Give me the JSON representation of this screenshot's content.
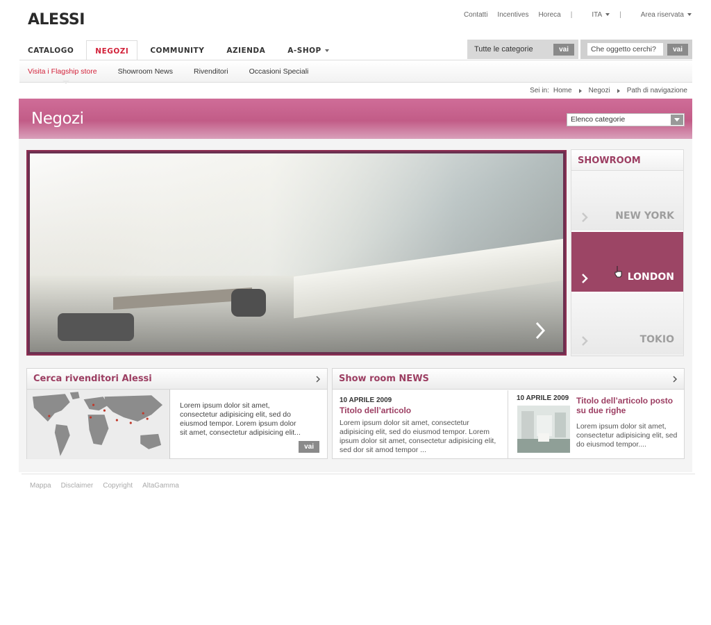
{
  "brand": {
    "logo": "ALESSI"
  },
  "top_links": {
    "contatti": "Contatti",
    "incentives": "Incentives",
    "horeca": "Horeca",
    "sep": "|",
    "language": "ITA",
    "area": "Area riservata"
  },
  "main_nav": [
    {
      "label": "CATALOGO"
    },
    {
      "label": "NEGOZI",
      "active": true
    },
    {
      "label": "COMMUNITY"
    },
    {
      "label": "AZIENDA"
    },
    {
      "label": "A-SHOP"
    }
  ],
  "search": {
    "category_label": "Tutte le categorie",
    "category_button": "vai",
    "query_placeholder": "Che oggetto cerchi?",
    "query_button": "vai"
  },
  "sub_nav": [
    {
      "label": "Visita i Flagship store",
      "active": true
    },
    {
      "label": "Showroom News"
    },
    {
      "label": "Rivenditori"
    },
    {
      "label": "Occasioni Speciali"
    }
  ],
  "breadcrumb": {
    "prefix": "Sei in:",
    "items": [
      "Home",
      "Negozi",
      "Path di navigazione"
    ]
  },
  "banner": {
    "title": "Negozi",
    "dropdown_value": "Elenco categorie"
  },
  "showroom": {
    "title": "SHOWROOM",
    "cities": [
      {
        "name": "NEW YORK",
        "active": false
      },
      {
        "name": "LONDON",
        "active": true
      },
      {
        "name": "TOKIO",
        "active": false
      }
    ]
  },
  "dealers": {
    "title": "Cerca rivenditori Alessi",
    "text": "Lorem ipsum dolor sit amet, consectetur adipisicing elit, sed do eiusmod tempor. Lorem ipsum dolor sit amet, consectetur adipisicing elit...",
    "button": "vai"
  },
  "news": {
    "title": "Show room NEWS",
    "items": [
      {
        "date": "10 APRILE 2009",
        "title": "Titolo dell’articolo",
        "body": "Lorem ipsum dolor sit amet, consectetur adipisicing elit, sed do eiusmod tempor. Lorem ipsum dolor sit amet, consectetur adipisicing elit, sed dor sit amod tempor ..."
      },
      {
        "date": "10 APRILE 2009",
        "title": "Titolo dell’articolo posto su due righe",
        "body": "Lorem ipsum dolor sit amet, consectetur adipisicing elit, sed do eiusmod tempor...."
      }
    ]
  },
  "footer": [
    "Mappa",
    "Disclaimer",
    "Copyright",
    "AltaGamma"
  ],
  "colors": {
    "accent_red": "#d2223a",
    "brand_plum": "#9c3e62",
    "banner_pink": "#c25c87",
    "button_gray": "#8a8a8a"
  }
}
